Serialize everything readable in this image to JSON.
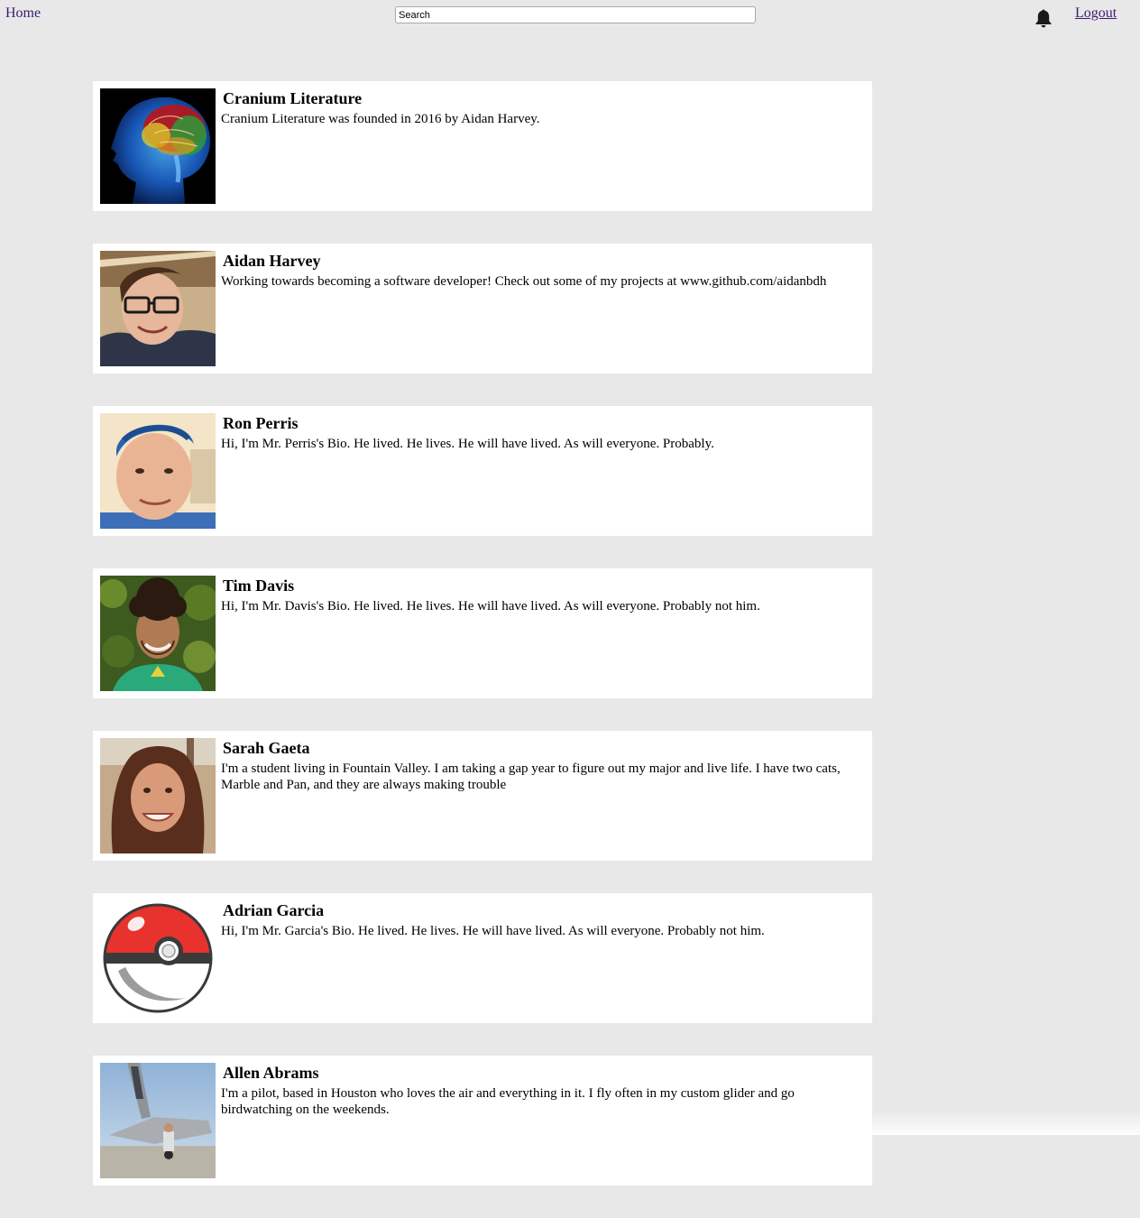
{
  "nav": {
    "home_label": "Home",
    "search_placeholder": "Search",
    "logout_label": "Logout",
    "notification_icon": "bell-icon"
  },
  "colors": {
    "page_background": "#e8e8e8",
    "card_background": "#ffffff",
    "link": "#3b1b72"
  },
  "profiles": [
    {
      "name": "Cranium Literature",
      "bio": "Cranium Literature was founded in 2016 by Aidan Harvey.",
      "avatar": "brain-xray-image"
    },
    {
      "name": "Aidan Harvey",
      "bio": "Working towards becoming a software developer! Check out some of my projects at www.github.com/aidanbdh",
      "avatar": "profile-photo"
    },
    {
      "name": "Ron Perris",
      "bio": "Hi, I'm Mr. Perris's Bio. He lived. He lives. He will have lived. As will everyone. Probably.",
      "avatar": "profile-photo"
    },
    {
      "name": "Tim Davis",
      "bio": "Hi, I'm Mr. Davis's Bio. He lived. He lives. He will have lived. As will everyone. Probably not him.",
      "avatar": "profile-photo"
    },
    {
      "name": "Sarah Gaeta",
      "bio": "I'm a student living in Fountain Valley. I am taking a gap year to figure out my major and live life. I have two cats, Marble and Pan, and they are always making trouble",
      "avatar": "profile-photo"
    },
    {
      "name": "Adrian Garcia",
      "bio": "Hi, I'm Mr. Garcia's Bio. He lived. He lives. He will have lived. As will everyone. Probably not him.",
      "avatar": "pokeball-image"
    },
    {
      "name": "Allen Abrams",
      "bio": "I'm a pilot, based in Houston who loves the air and everything in it. I fly often in my custom glider and go birdwatching on the weekends.",
      "avatar": "aircraft-photo"
    }
  ]
}
